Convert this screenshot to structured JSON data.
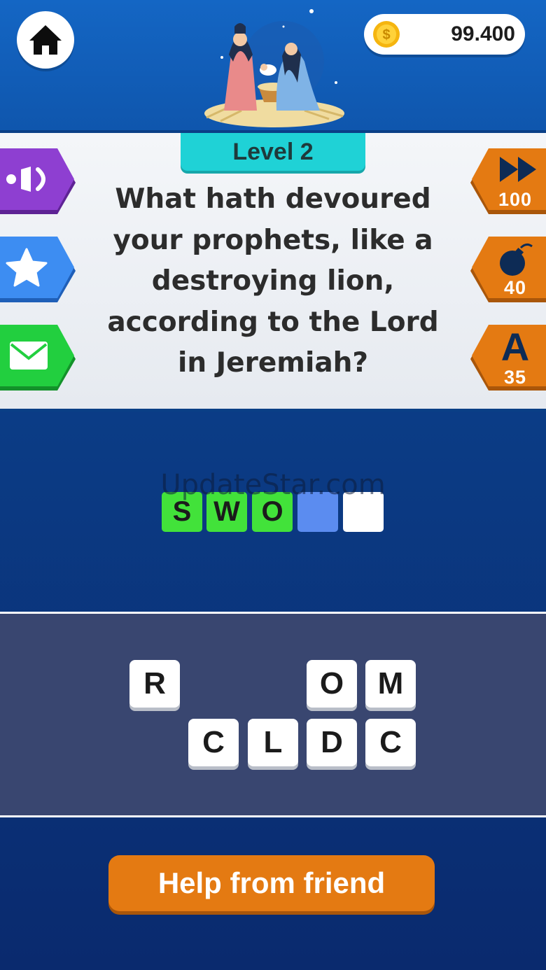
{
  "header": {
    "home_icon": "home-icon",
    "coin_icon": "coin-icon",
    "coin_symbol": "$",
    "coins": "99.400",
    "illustration": "nativity-illustration"
  },
  "question": {
    "level_label": "Level 2",
    "text": "What hath devoured your prophets, like a destroying lion, according to the Lord in Jeremiah?"
  },
  "left_tools": [
    {
      "name": "sound-button",
      "icon": "speaker-icon",
      "color": "#8e3fd1"
    },
    {
      "name": "favorite-button",
      "icon": "star-icon",
      "color": "#3d8df2"
    },
    {
      "name": "share-button",
      "icon": "envelope-icon",
      "color": "#22cf3f"
    }
  ],
  "right_tools": [
    {
      "name": "skip-level-button",
      "icon": "fast-forward-icon",
      "cost": "100",
      "color": "#e47a12"
    },
    {
      "name": "remove-letters-button",
      "icon": "bomb-icon",
      "cost": "40",
      "color": "#e47a12"
    },
    {
      "name": "reveal-letter-button",
      "glyph": "A",
      "cost": "35",
      "color": "#e47a12"
    }
  ],
  "watermark": "UpdateStar.com",
  "answer_slots": [
    {
      "letter": "S",
      "state": "filled"
    },
    {
      "letter": "W",
      "state": "filled"
    },
    {
      "letter": "O",
      "state": "filled"
    },
    {
      "letter": "",
      "state": "active"
    },
    {
      "letter": "",
      "state": "empty"
    }
  ],
  "letter_pool": {
    "row1": [
      "R",
      "",
      "",
      "O",
      "M"
    ],
    "row2": [
      "",
      "C",
      "L",
      "D",
      "C"
    ]
  },
  "help_button_label": "Help from friend"
}
